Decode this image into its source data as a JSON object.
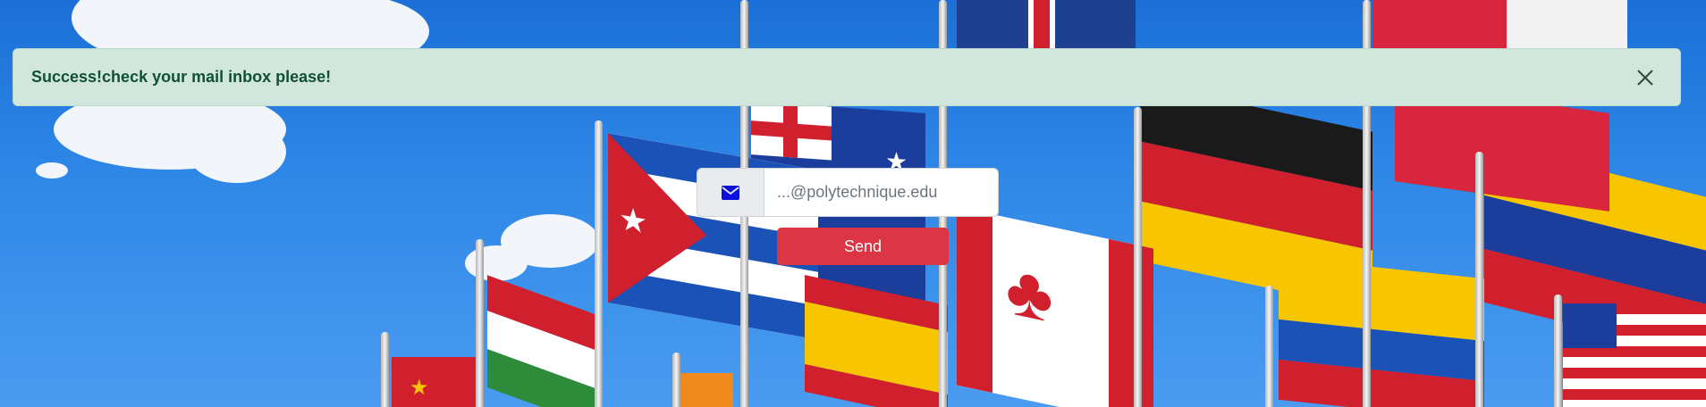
{
  "alert": {
    "message": "Success!check your mail inbox please!",
    "type": "success",
    "close_icon": "close-icon"
  },
  "form": {
    "email_placeholder": "...@polytechnique.edu",
    "email_value": "",
    "email_icon": "envelope-icon",
    "send_label": "Send"
  },
  "colors": {
    "alert_bg": "#d1e7dd",
    "alert_text": "#0f5132",
    "send_button": "#dc3545",
    "sky": "#2d86e6"
  }
}
